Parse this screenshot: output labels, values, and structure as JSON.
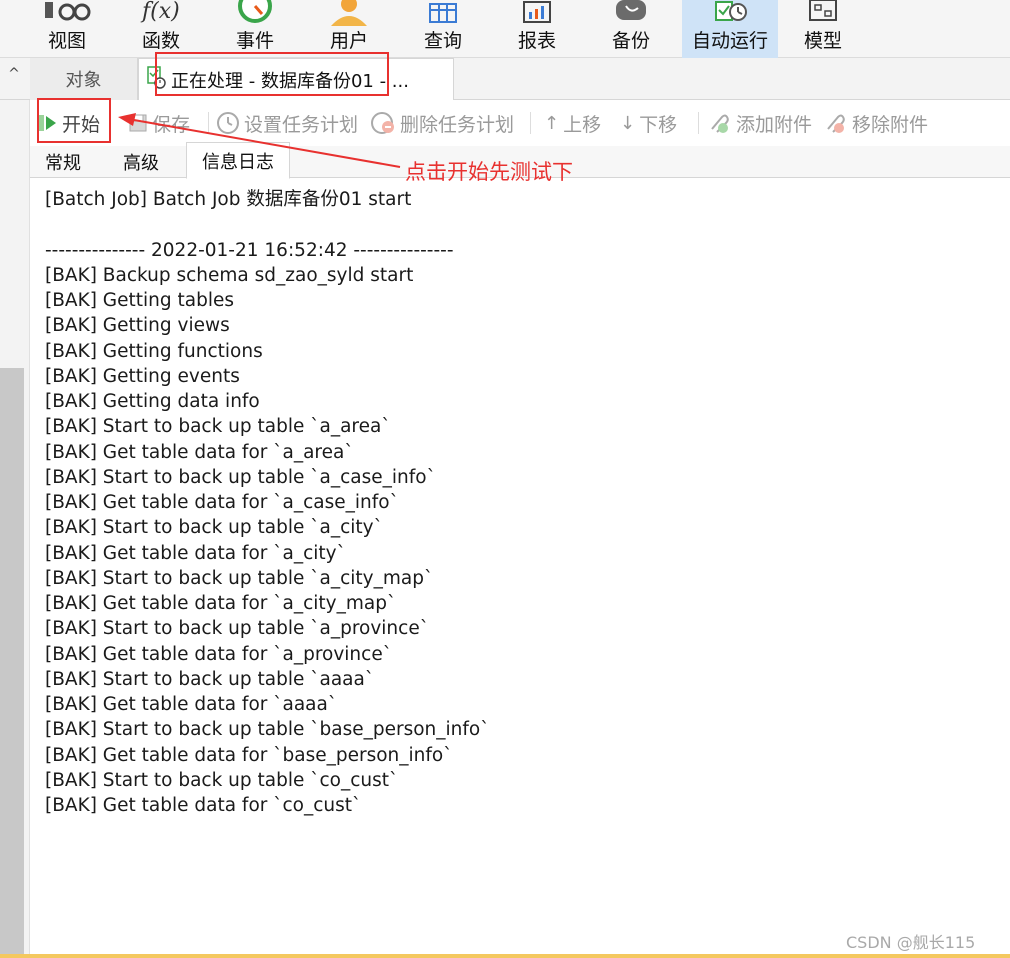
{
  "ribbon": {
    "items": [
      {
        "label": "视图",
        "icon": "view-icon"
      },
      {
        "label": "函数",
        "icon": "function-icon"
      },
      {
        "label": "事件",
        "icon": "event-icon"
      },
      {
        "label": "用户",
        "icon": "user-icon"
      },
      {
        "label": "查询",
        "icon": "query-icon"
      },
      {
        "label": "报表",
        "icon": "report-icon"
      },
      {
        "label": "备份",
        "icon": "backup-icon"
      },
      {
        "label": "自动运行",
        "icon": "automation-icon",
        "active": true
      },
      {
        "label": "模型",
        "icon": "model-icon"
      }
    ],
    "active_color": "#cfe3f7"
  },
  "tabs": {
    "collapse": "^",
    "objects": "对象",
    "processing": "正在处理 - 数据库备份01 - ..."
  },
  "toolbar": {
    "start": "开始",
    "save": "保存",
    "set_schedule": "设置任务计划",
    "delete_schedule": "删除任务计划",
    "move_up": "上移",
    "move_down": "下移",
    "add_attachment": "添加附件",
    "remove_attachment": "移除附件"
  },
  "subtabs": {
    "general": "常规",
    "advanced": "高级",
    "log": "信息日志"
  },
  "annotation": {
    "text": "点击开始先测试下",
    "color": "#e8312f"
  },
  "log_lines": [
    "[Batch Job] Batch Job 数据库备份01 start",
    "",
    "--------------- 2022-01-21 16:52:42 ---------------",
    "[BAK] Backup schema sd_zao_syld start",
    "[BAK] Getting tables",
    "[BAK] Getting views",
    "[BAK] Getting functions",
    "[BAK] Getting events",
    "[BAK] Getting data info",
    "[BAK] Start to back up table `a_area`",
    "[BAK] Get table data for `a_area`",
    "[BAK] Start to back up table `a_case_info`",
    "[BAK] Get table data for `a_case_info`",
    "[BAK] Start to back up table `a_city`",
    "[BAK] Get table data for `a_city`",
    "[BAK] Start to back up table `a_city_map`",
    "[BAK] Get table data for `a_city_map`",
    "[BAK] Start to back up table `a_province`",
    "[BAK] Get table data for `a_province`",
    "[BAK] Start to back up table `aaaa`",
    "[BAK] Get table data for `aaaa`",
    "[BAK] Start to back up table `base_person_info`",
    "[BAK] Get table data for `base_person_info`",
    "[BAK] Start to back up table `co_cust`",
    "[BAK] Get table data for `co_cust`"
  ],
  "watermark": "CSDN @舰长115"
}
